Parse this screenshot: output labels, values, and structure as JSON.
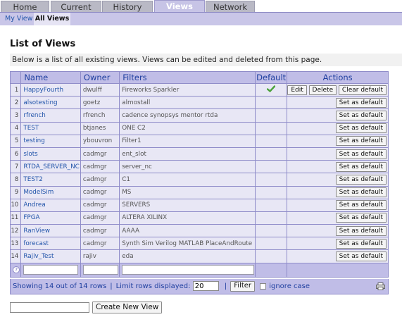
{
  "tabs": [
    {
      "label": "Home"
    },
    {
      "label": "Current"
    },
    {
      "label": "History"
    },
    {
      "label": "Views"
    },
    {
      "label": "Network"
    }
  ],
  "subtabs": {
    "my_view": "My View",
    "all_views": "All Views"
  },
  "page_title": "List of Views",
  "intro": "Below is a list of all existing views. Views can be edited and deleted from this page.",
  "columns": {
    "name": "Name",
    "owner": "Owner",
    "filters": "Filters",
    "default": "Default",
    "actions": "Actions"
  },
  "buttons": {
    "edit": "Edit",
    "delete": "Delete",
    "clear_default": "Clear default",
    "set_default": "Set as default",
    "filter": "Filter",
    "create_new_view": "Create New View"
  },
  "rows": [
    {
      "num": "1",
      "name": "HappyFourth",
      "owner": "dwulff",
      "filters": "Fireworks Sparkler",
      "is_default": true
    },
    {
      "num": "2",
      "name": "alsotesting",
      "owner": "goetz",
      "filters": "almostall",
      "is_default": false
    },
    {
      "num": "3",
      "name": "rfrench",
      "owner": "rfrench",
      "filters": "cadence synopsys mentor rtda",
      "is_default": false
    },
    {
      "num": "4",
      "name": "TEST",
      "owner": "btjanes",
      "filters": "ONE C2",
      "is_default": false
    },
    {
      "num": "5",
      "name": "testing",
      "owner": "ybouvron",
      "filters": "Filter1",
      "is_default": false
    },
    {
      "num": "6",
      "name": "slots",
      "owner": "cadmgr",
      "filters": "ent_slot",
      "is_default": false
    },
    {
      "num": "7",
      "name": "RTDA_SERVER_NC",
      "owner": "cadmgr",
      "filters": "server_nc",
      "is_default": false
    },
    {
      "num": "8",
      "name": "TEST2",
      "owner": "cadmgr",
      "filters": "C1",
      "is_default": false
    },
    {
      "num": "9",
      "name": "ModelSim",
      "owner": "cadmgr",
      "filters": "MS",
      "is_default": false
    },
    {
      "num": "10",
      "name": "Andrea",
      "owner": "cadmgr",
      "filters": "SERVERS",
      "is_default": false
    },
    {
      "num": "11",
      "name": "FPGA",
      "owner": "cadmgr",
      "filters": "ALTERA XILINX",
      "is_default": false
    },
    {
      "num": "12",
      "name": "RanView",
      "owner": "cadmgr",
      "filters": "AAAA",
      "is_default": false
    },
    {
      "num": "13",
      "name": "forecast",
      "owner": "cadmgr",
      "filters": "Synth Sim Verilog MATLAB PlaceAndRoute",
      "is_default": false
    },
    {
      "num": "14",
      "name": "Rajiv_Test",
      "owner": "rajiv",
      "filters": "eda",
      "is_default": false
    }
  ],
  "filter_row": {
    "help_glyph": "?"
  },
  "footer": {
    "showing": "Showing 14 out of 14 rows",
    "limit_label": "Limit rows displayed:",
    "limit_value": "20",
    "ignore_case": "ignore case",
    "separator": "|"
  },
  "colors": {
    "accent": "#c0bde7",
    "link": "#2255aa",
    "check": "#4aa23a"
  },
  "icons": {
    "default_marker": "checkmark-icon",
    "print": "print-icon",
    "help": "help-icon"
  }
}
